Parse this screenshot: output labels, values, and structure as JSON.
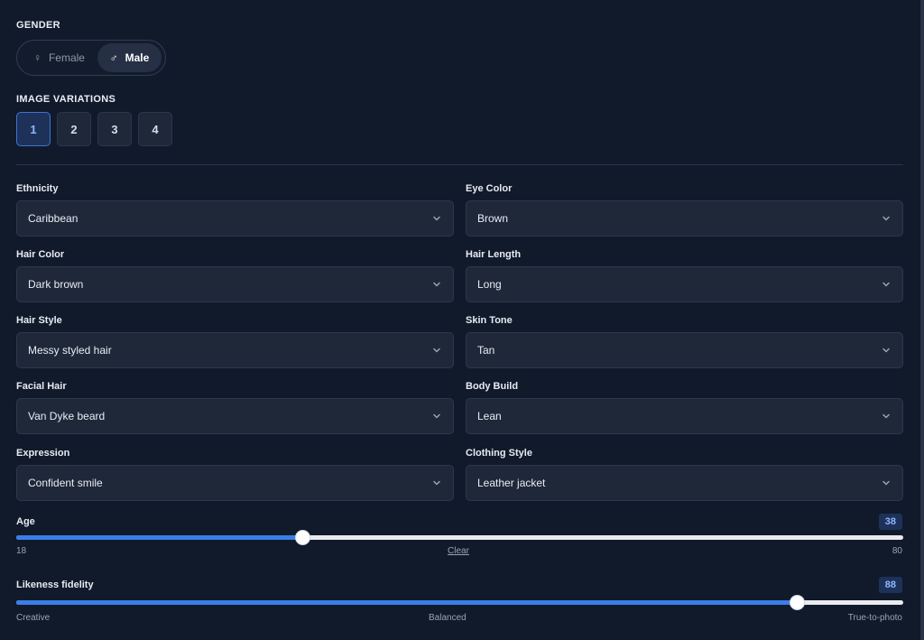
{
  "gender": {
    "label": "GENDER",
    "options": [
      {
        "label": "Female",
        "icon": "♀"
      },
      {
        "label": "Male",
        "icon": "♂"
      }
    ],
    "selected": "Male"
  },
  "variations": {
    "label": "IMAGE VARIATIONS",
    "options": [
      "1",
      "2",
      "3",
      "4"
    ],
    "selected": "1"
  },
  "fields": {
    "ethnicity": {
      "label": "Ethnicity",
      "value": "Caribbean"
    },
    "eye_color": {
      "label": "Eye Color",
      "value": "Brown"
    },
    "hair_color": {
      "label": "Hair Color",
      "value": "Dark brown"
    },
    "hair_length": {
      "label": "Hair Length",
      "value": "Long"
    },
    "hair_style": {
      "label": "Hair Style",
      "value": "Messy styled hair"
    },
    "skin_tone": {
      "label": "Skin Tone",
      "value": "Tan"
    },
    "facial_hair": {
      "label": "Facial Hair",
      "value": "Van Dyke beard"
    },
    "body_build": {
      "label": "Body Build",
      "value": "Lean"
    },
    "expression": {
      "label": "Expression",
      "value": "Confident smile"
    },
    "clothing_style": {
      "label": "Clothing Style",
      "value": "Leather jacket"
    }
  },
  "age": {
    "label": "Age",
    "value": "38",
    "min": "18",
    "max": "80",
    "clear_label": "Clear"
  },
  "likeness": {
    "label": "Likeness fidelity",
    "value": "88",
    "left_label": "Creative",
    "mid_label": "Balanced",
    "right_label": "True-to-photo"
  },
  "colors": {
    "accent": "#3b7ee8",
    "background": "#111a2b",
    "field": "#1f2839"
  }
}
